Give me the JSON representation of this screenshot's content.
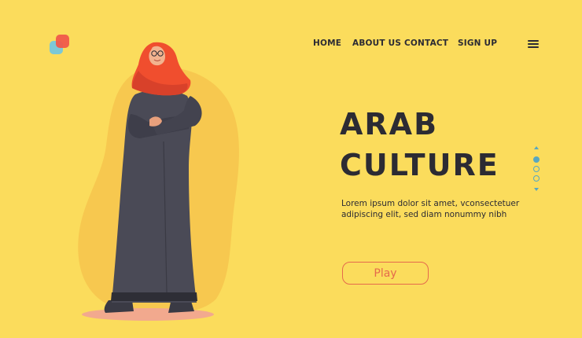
{
  "nav": {
    "home": "HOME",
    "about": "ABOUT US",
    "contact": "CONTACT",
    "signup": "SIGN UP"
  },
  "hero": {
    "title_line1": "ARAB",
    "title_line2": "CULTURE",
    "description": "Lorem ipsum dolor sit amet, vconsectetuer adipiscing elit, sed diam nonummy nibh",
    "play_label": "Play"
  },
  "pagination": {
    "active": 1,
    "total": 3
  },
  "colors": {
    "background": "#FBDC5C",
    "text": "#2C2B33",
    "accent": "#E56A4C",
    "pager": "#58A7C0",
    "hijab": "#F04E2E",
    "abaya": "#4A4A56"
  },
  "icons": {
    "logo": "two-rounded-squares",
    "menu": "hamburger-icon",
    "pager_up": "triangle-up-icon",
    "pager_down": "triangle-down-icon"
  }
}
